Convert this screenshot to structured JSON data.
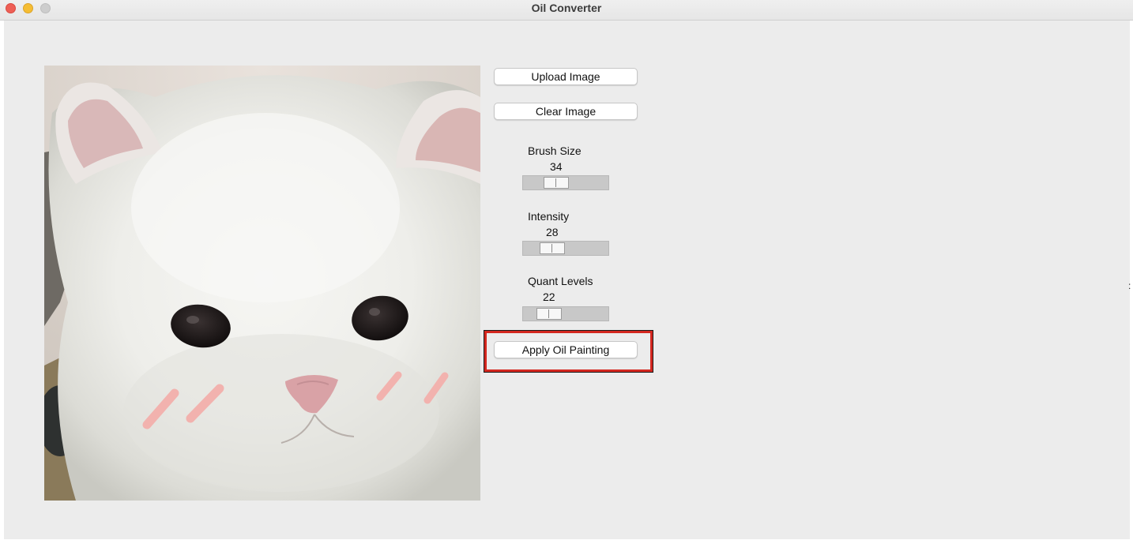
{
  "window": {
    "title": "Oil Converter"
  },
  "buttons": {
    "upload": "Upload Image",
    "clear": "Clear Image",
    "apply": "Apply Oil Painting"
  },
  "sliders": {
    "brush_size": {
      "label": "Brush Size",
      "value": "34",
      "fraction": 0.34
    },
    "intensity": {
      "label": "Intensity",
      "value": "28",
      "fraction": 0.28
    },
    "quant_levels": {
      "label": "Quant Levels",
      "value": "22",
      "fraction": 0.22
    }
  },
  "image": {
    "subject": "white-cat-photo"
  },
  "colors": {
    "highlight": "#d4271f"
  }
}
